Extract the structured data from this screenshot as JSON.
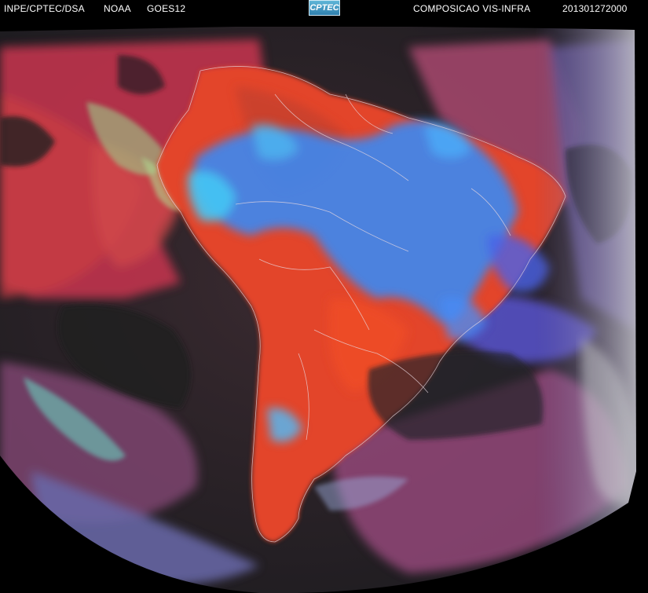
{
  "header": {
    "org": "INPE/CPTEC/DSA",
    "agency": "NOAA",
    "satellite": "GOES12",
    "logo_text": "CPTEC",
    "product": "COMPOSICAO VIS-INFRA",
    "datetime": "201301272000"
  },
  "colors": {
    "land_surface": "#e8452a",
    "ocean_clear": "#222226",
    "cold_cloud": "#3a8cff",
    "thin_cloud": "#c8508a",
    "low_cloud": "#8fd6a0",
    "night_side": "#b8b8b8"
  }
}
